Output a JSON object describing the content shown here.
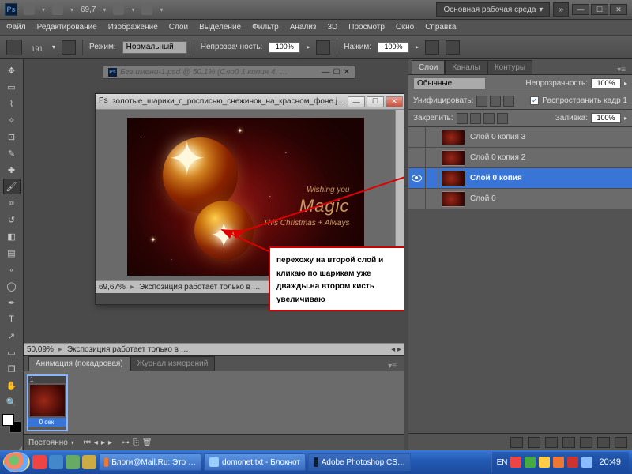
{
  "titlebar": {
    "zoom": "69,7",
    "workspace_btn": "Основная рабочая среда"
  },
  "menus": [
    "Файл",
    "Редактирование",
    "Изображение",
    "Слои",
    "Выделение",
    "Фильтр",
    "Анализ",
    "3D",
    "Просмотр",
    "Окно",
    "Справка"
  ],
  "options": {
    "brush_size": "191",
    "mode_label": "Режим:",
    "mode_value": "Нормальный",
    "opacity_label": "Непрозрачность:",
    "opacity_value": "100%",
    "flow_label": "Нажим:",
    "flow_value": "100%"
  },
  "doc_tab": "Без имени-1.psd @ 50,1% (Слой 1 копия 4, …",
  "doc_window": {
    "title": "золотые_шарики_с_росписью_снежинок_на_красном_фоне.j…",
    "status_zoom": "69,67%",
    "status_text": "Экспозиция работает только в …",
    "magic_small1": "Wishing you",
    "magic_big": "Magic",
    "magic_small2": "This Christmas + Always"
  },
  "outer_status": {
    "zoom": "50,09%",
    "text": "Экспозиция работает только в …"
  },
  "callout_text": "перехожу на второй слой и кликаю по шарикам уже дважды.на втором кисть увеличиваю",
  "layers_panel": {
    "tabs": [
      "Слои",
      "Каналы",
      "Контуры"
    ],
    "blend": "Обычные",
    "opacity_label": "Непрозрачность:",
    "opacity": "100%",
    "unify_label": "Унифицировать:",
    "propagate_label": "Распространить кадр 1",
    "lock_label": "Закрепить:",
    "fill_label": "Заливка:",
    "fill": "100%",
    "layers": [
      {
        "name": "Слой 0 копия 3",
        "vis": false,
        "sel": false
      },
      {
        "name": "Слой 0 копия 2",
        "vis": false,
        "sel": false
      },
      {
        "name": "Слой 0 копия",
        "vis": true,
        "sel": true
      },
      {
        "name": "Слой 0",
        "vis": false,
        "sel": false
      }
    ]
  },
  "anim": {
    "tabs": [
      "Анимация (покадровая)",
      "Журнал измерений"
    ],
    "frame_num": "1",
    "frame_time": "0 сек.",
    "loop": "Постоянно"
  },
  "taskbar": {
    "items": [
      "Блоги@Mail.Ru: Это …",
      "domonet.txt - Блокнот",
      "Adobe Photoshop CS…"
    ],
    "lang": "EN",
    "time": "20:49"
  }
}
